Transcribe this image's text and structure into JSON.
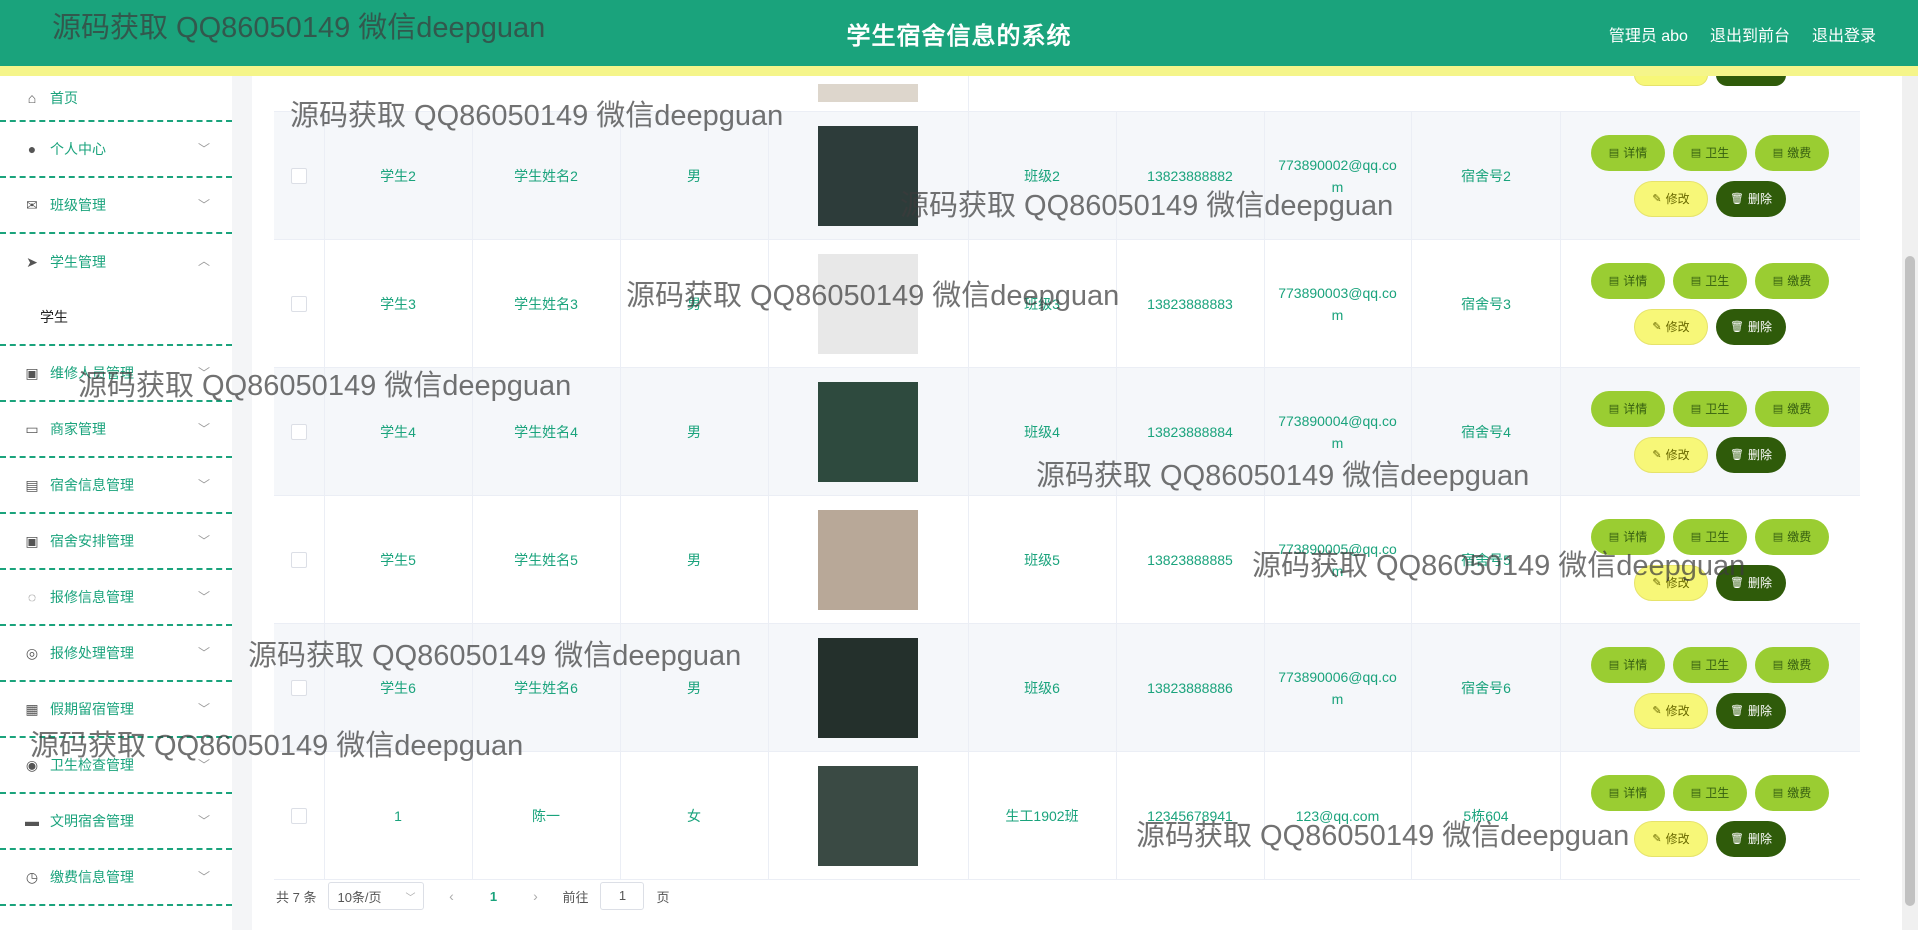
{
  "header": {
    "title": "学生宿舍信息的系统",
    "admin": "管理员 abo",
    "to_front": "退出到前台",
    "logout": "退出登录"
  },
  "sidebar": {
    "items": [
      {
        "label": "首页",
        "icon": "home-icon"
      },
      {
        "label": "个人中心",
        "icon": "user-icon"
      },
      {
        "label": "班级管理",
        "icon": "mail-icon"
      },
      {
        "label": "学生管理",
        "icon": "send-icon",
        "expanded": true
      },
      {
        "label": "维修人员管理",
        "icon": "clipboard-icon"
      },
      {
        "label": "商家管理",
        "icon": "card-icon"
      },
      {
        "label": "宿舍信息管理",
        "icon": "briefcase-icon"
      },
      {
        "label": "宿舍安排管理",
        "icon": "clipboard-icon"
      },
      {
        "label": "报修信息管理",
        "icon": "bell-off-icon"
      },
      {
        "label": "报修处理管理",
        "icon": "compass-icon"
      },
      {
        "label": "假期留宿管理",
        "icon": "grid-icon"
      },
      {
        "label": "卫生检查管理",
        "icon": "target-icon"
      },
      {
        "label": "文明宿舍管理",
        "icon": "chat-icon"
      },
      {
        "label": "缴费信息管理",
        "icon": "clock-icon"
      }
    ],
    "sub_item": "学生"
  },
  "rows": [
    {
      "id": "学生2",
      "name": "学生姓名2",
      "gender": "男",
      "class": "班级2",
      "phone": "13823888882",
      "email": "773890002@qq.com",
      "dorm": "宿舍号2",
      "photo_bg": "#2d3c3a"
    },
    {
      "id": "学生3",
      "name": "学生姓名3",
      "gender": "男",
      "class": "班级3",
      "phone": "13823888883",
      "email": "773890003@qq.com",
      "dorm": "宿舍号3",
      "photo_bg": "#e8e8e8"
    },
    {
      "id": "学生4",
      "name": "学生姓名4",
      "gender": "男",
      "class": "班级4",
      "phone": "13823888884",
      "email": "773890004@qq.com",
      "dorm": "宿舍号4",
      "photo_bg": "#2e4a3e"
    },
    {
      "id": "学生5",
      "name": "学生姓名5",
      "gender": "男",
      "class": "班级5",
      "phone": "13823888885",
      "email": "773890005@qq.com",
      "dorm": "宿舍号5",
      "photo_bg": "#b8a898"
    },
    {
      "id": "学生6",
      "name": "学生姓名6",
      "gender": "男",
      "class": "班级6",
      "phone": "13823888886",
      "email": "773890006@qq.com",
      "dorm": "宿舍号6",
      "photo_bg": "#24302c"
    },
    {
      "id": "1",
      "name": "陈一",
      "gender": "女",
      "class": "生工1902班",
      "phone": "12345678941",
      "email": "123@qq.com",
      "dorm": "5栋604",
      "photo_bg": "#3a4a44"
    }
  ],
  "actions": {
    "detail": "详情",
    "hygiene": "卫生",
    "fee": "缴费",
    "edit": "修改",
    "delete": "删除"
  },
  "pager": {
    "total": "共 7 条",
    "page_size": "10条/页",
    "current": "1",
    "goto_prefix": "前往",
    "goto_value": "1",
    "goto_suffix": "页"
  },
  "watermark": "源码获取 QQ86050149 微信deepguan",
  "colors": {
    "primary": "#1aa37c",
    "accent_bar": "#f5f58a",
    "btn_green": "#9acd32",
    "btn_yellow": "#f7f778",
    "btn_dark": "#2f5b0a"
  }
}
